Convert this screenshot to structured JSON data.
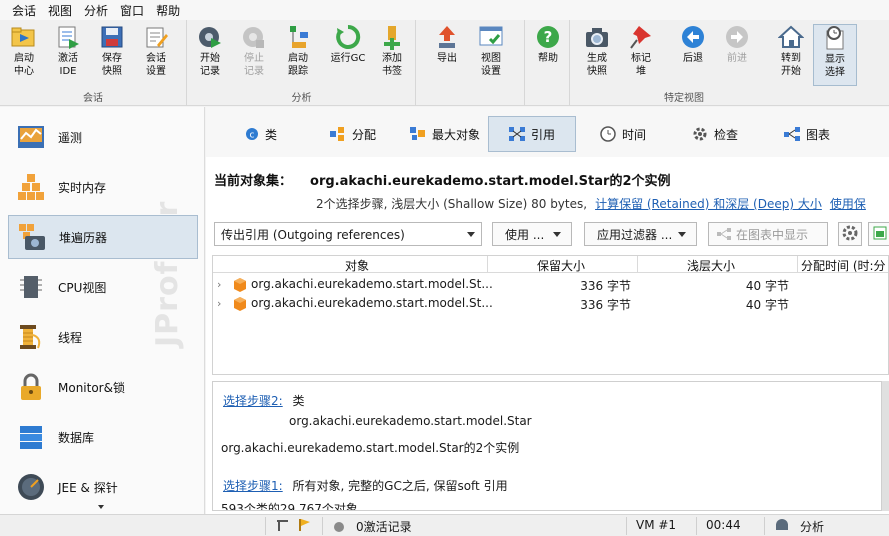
{
  "menu": [
    "会话",
    "视图",
    "分析",
    "窗口",
    "帮助"
  ],
  "toolbar": {
    "groups": [
      {
        "label": "会话"
      },
      {
        "label": "分析"
      },
      {
        "label": ""
      },
      {
        "label": "特定视图"
      }
    ],
    "buttons": [
      {
        "label": "启动\n中心",
        "icon": "folder-play-icon"
      },
      {
        "label": "激活\nIDE",
        "icon": "ide-icon"
      },
      {
        "label": "保存\n快照",
        "icon": "save-icon"
      },
      {
        "label": "会话\n设置",
        "icon": "session-settings-icon"
      },
      {
        "label": "开始\n记录",
        "icon": "record-start-icon"
      },
      {
        "label": "停止\n记录",
        "icon": "record-stop-icon"
      },
      {
        "label": "启动\n跟踪",
        "icon": "tracking-icon"
      },
      {
        "label": "运行GC",
        "icon": "gc-icon"
      },
      {
        "label": "添加\n书签",
        "icon": "bookmark-add-icon"
      },
      {
        "label": "导出",
        "icon": "export-icon"
      },
      {
        "label": "视图\n设置",
        "icon": "view-settings-icon"
      },
      {
        "label": "帮助",
        "icon": "help-icon"
      },
      {
        "label": "生成\n快照",
        "icon": "camera-icon"
      },
      {
        "label": "标记\n堆",
        "icon": "pin-icon"
      },
      {
        "label": "后退",
        "icon": "back-icon"
      },
      {
        "label": "前进",
        "icon": "forward-icon"
      },
      {
        "label": "转到\n开始",
        "icon": "home-icon"
      },
      {
        "label": "显示\n选择",
        "icon": "show-selection-icon"
      }
    ]
  },
  "sidebar": {
    "items": [
      {
        "label": "遥测",
        "icon": "telemetry-icon"
      },
      {
        "label": "实时内存",
        "icon": "live-memory-icon"
      },
      {
        "label": "堆遍历器",
        "icon": "heap-walker-icon"
      },
      {
        "label": "CPU视图",
        "icon": "cpu-icon"
      },
      {
        "label": "线程",
        "icon": "threads-icon"
      },
      {
        "label": "Monitor&锁",
        "icon": "lock-icon"
      },
      {
        "label": "数据库",
        "icon": "database-icon"
      },
      {
        "label": "JEE & 探针",
        "icon": "probe-icon"
      }
    ],
    "watermark": "JProfiler"
  },
  "tabs": [
    {
      "label": "类",
      "icon": "class-icon"
    },
    {
      "label": "分配",
      "icon": "allocation-icon"
    },
    {
      "label": "最大对象",
      "icon": "biggest-objects-icon"
    },
    {
      "label": "引用",
      "icon": "references-icon"
    },
    {
      "label": "时间",
      "icon": "time-icon"
    },
    {
      "label": "检查",
      "icon": "inspections-icon"
    },
    {
      "label": "图表",
      "icon": "graph-icon"
    }
  ],
  "object_set": {
    "title": "当前对象集：",
    "value": "org.akachi.eurekademo.start.model.Star的2个实例",
    "subtitle": "2个选择步骤, 浅层大小 (Shallow Size) 80 bytes,",
    "link1": "计算保留 (Retained) 和深层 (Deep) 大小",
    "link2": "使用保"
  },
  "controls": {
    "reference_type": "传出引用 (Outgoing references)",
    "use_button": "使用 ...",
    "filter_button": "应用过滤器 ...",
    "graph_button": "在图表中显示"
  },
  "table": {
    "columns": [
      "对象",
      "保留大小",
      "浅层大小",
      "分配时间 (时:分"
    ],
    "rows": [
      {
        "object": "org.akachi.eurekademo.start.model.St...",
        "retained": "336 字节",
        "shallow": "40 字节"
      },
      {
        "object": "org.akachi.eurekademo.start.model.St...",
        "retained": "336 字节",
        "shallow": "40 字节"
      }
    ]
  },
  "detail": {
    "step2_link": "选择步骤2:",
    "step2_kind": "类",
    "step2_class": "org.akachi.eurekademo.start.model.Star",
    "instances": "org.akachi.eurekademo.start.model.Star的2个实例",
    "step1_link": "选择步骤1:",
    "step1_text": "所有对象, 完整的GC之后, 保留soft 引用",
    "step1_count": "593个类的29,767个对象"
  },
  "status": {
    "recordings": "0激活记录",
    "vm": "VM #1",
    "time": "00:44",
    "mode": "分析"
  },
  "colors": {
    "accent": "#1e5fb3",
    "selection_bg": "#dce6ef",
    "selection_border": "#a9bdd0",
    "object_icon": "#f08a1c"
  }
}
